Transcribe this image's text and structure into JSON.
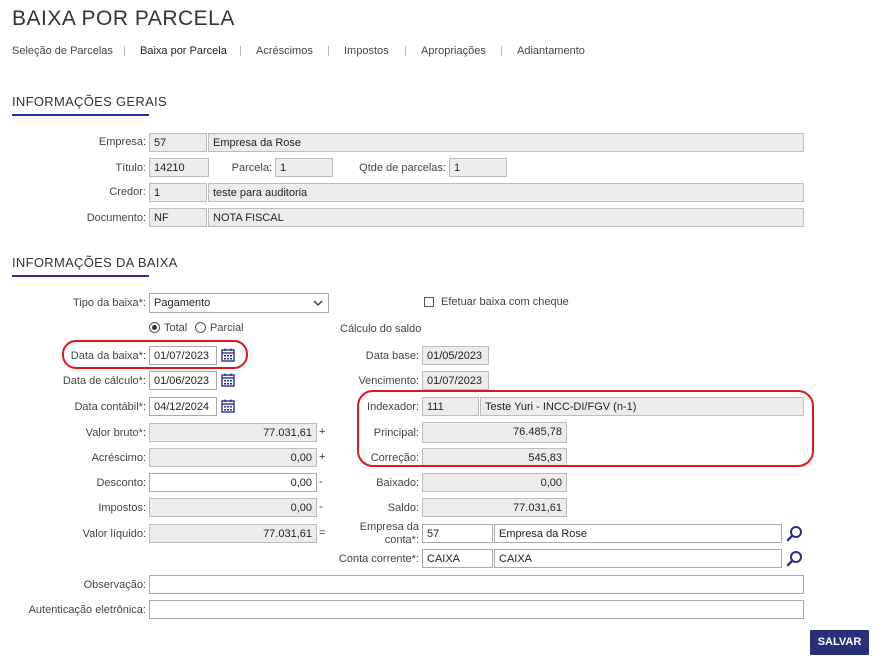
{
  "page": {
    "title": "BAIXA POR PARCELA"
  },
  "tabs": [
    "Seleção de Parcelas",
    "Baixa por Parcela",
    "Acréscimos",
    "Impostos",
    "Apropriações",
    "Adiantamento"
  ],
  "gerais": {
    "heading": "INFORMAÇÕES GERAIS",
    "empresa_label": "Empresa:",
    "empresa_code": "57",
    "empresa_name": "Empresa da Rose",
    "titulo_label": "Título:",
    "titulo_value": "14210",
    "parcela_label": "Parcela:",
    "parcela_value": "1",
    "qtde_label": "Qtde de parcelas:",
    "qtde_value": "1",
    "credor_label": "Credor:",
    "credor_code": "1",
    "credor_name": "teste para auditoria",
    "documento_label": "Documento:",
    "documento_code": "NF",
    "documento_name": "NOTA FISCAL"
  },
  "baixa": {
    "heading": "INFORMAÇÕES DA BAIXA",
    "tipo_label": "Tipo da baixa*:",
    "tipo_value": "Pagamento",
    "cheque_label": "Efetuar baixa com cheque",
    "radio_total": "Total",
    "radio_parcial": "Parcial",
    "calc_saldo_label": "Cálculo do saldo",
    "data_baixa_label": "Data da baixa*:",
    "data_baixa_value": "01/07/2023",
    "data_calculo_label": "Data de cálculo*:",
    "data_calculo_value": "01/06/2023",
    "data_contabil_label": "Data contábil*:",
    "data_contabil_value": "04/12/2024",
    "valor_bruto_label": "Valor bruto*:",
    "valor_bruto_value": "77.031,61",
    "valor_bruto_sym": "+",
    "acrescimo_label": "Acréscimo:",
    "acrescimo_value": "0,00",
    "acrescimo_sym": "+",
    "desconto_label": "Desconto:",
    "desconto_value": "0,00",
    "desconto_sym": "-",
    "impostos_label": "Impostos:",
    "impostos_value": "0,00",
    "impostos_sym": "-",
    "valor_liquido_label": "Valor líquido:",
    "valor_liquido_value": "77.031,61",
    "valor_liquido_sym": "=",
    "data_base_label": "Data base:",
    "data_base_value": "01/05/2023",
    "vencimento_label": "Vencimento:",
    "vencimento_value": "01/07/2023",
    "indexador_label": "Indexador:",
    "indexador_code": "111",
    "indexador_name": "Teste Yuri -  INCC-DI/FGV (n-1)",
    "principal_label": "Principal:",
    "principal_value": "76.485,78",
    "correcao_label": "Correção:",
    "correcao_value": "545,83",
    "baixado_label": "Baixado:",
    "baixado_value": "0,00",
    "saldo_label": "Saldo:",
    "saldo_value": "77.031,61",
    "empresa_conta_label_1": "Empresa da",
    "empresa_conta_label_2": "conta*:",
    "empresa_conta_code": "57",
    "empresa_conta_name": "Empresa da Rose",
    "conta_corrente_label": "Conta corrente*:",
    "conta_corrente_code": "CAIXA",
    "conta_corrente_name": "CAIXA",
    "observacao_label": "Observação:",
    "observacao_value": "",
    "autenticacao_label": "Autenticação eletrônica:",
    "autenticacao_value": ""
  },
  "actions": {
    "salvar": "SALVAR"
  },
  "colors": {
    "accent": "#2b2f8f",
    "highlight": "#e0161b",
    "button": "#2b2f7a"
  },
  "icons": [
    "calendar-icon",
    "search-icon",
    "chevron-down-icon"
  ]
}
